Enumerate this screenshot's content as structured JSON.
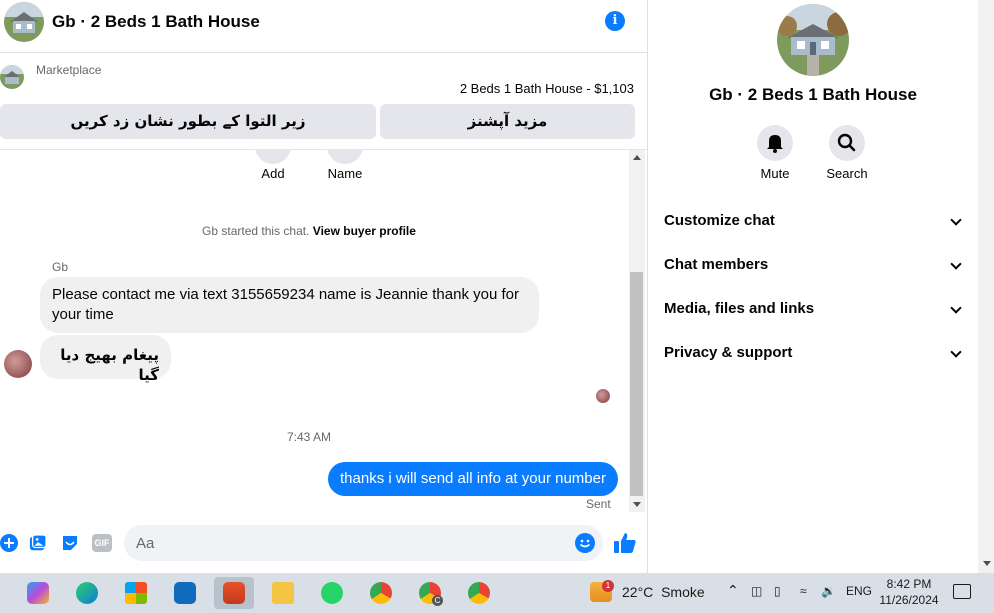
{
  "header": {
    "title": "Gb · 2 Beds 1 Bath House"
  },
  "listing": {
    "source_label": "Marketplace",
    "item_title": "2 Beds 1 Bath House - $1,103",
    "mark_pending_label": "زیر التوا کے بطور نشان زد کریں",
    "more_options_label": "مزید آپشنز"
  },
  "thread": {
    "actions": [
      {
        "label": "Add"
      },
      {
        "label": "Name"
      }
    ],
    "started_note": "Gb started this chat.",
    "view_profile_link": "View buyer profile",
    "sender_name": "Gb",
    "incoming": [
      "Please contact me via text 3155659234 name is Jeannie thank you for your time",
      "پیغام بھیج دیا گیا"
    ],
    "timestamp": "7:43 AM",
    "outgoing": "thanks i will send all info at your number",
    "status": "Sent"
  },
  "composer": {
    "placeholder": "Aa",
    "gif_label": "GIF"
  },
  "profile": {
    "name": "Gb · 2 Beds 1 Bath House",
    "mute_label": "Mute",
    "search_label": "Search",
    "sections": [
      "Customize chat",
      "Chat members",
      "Media, files and links",
      "Privacy & support"
    ]
  },
  "taskbar": {
    "weather_temp": "22°C",
    "weather_desc": "Smoke",
    "language": "ENG",
    "time": "8:42 PM",
    "date": "11/26/2024",
    "notification_badge": "1",
    "chrome_badge": "C"
  },
  "colors": {
    "accent": "#0a7cff",
    "bubble_in": "#f0f0f0",
    "taskbar": "#d8dfe6"
  }
}
